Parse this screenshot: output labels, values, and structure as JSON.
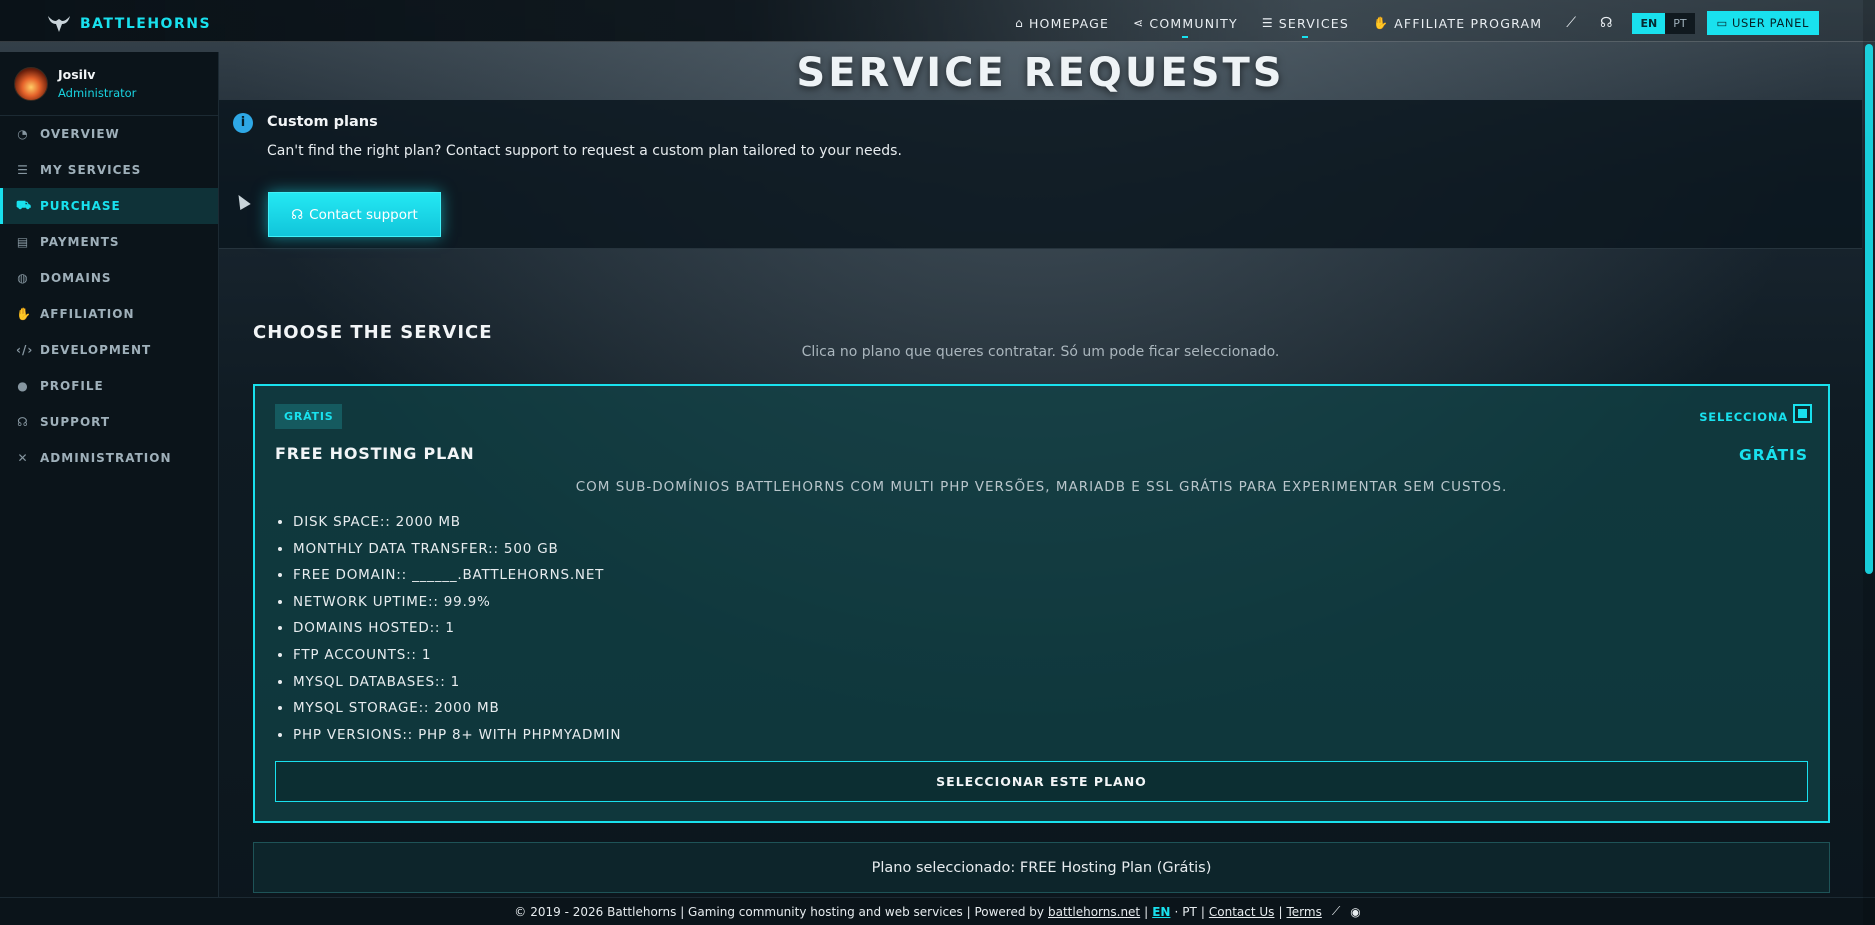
{
  "brand": {
    "name": "BATTLEHORNS"
  },
  "nav": {
    "items": [
      {
        "label": "HOMEPAGE",
        "icon": "home-icon"
      },
      {
        "label": "COMMUNITY",
        "icon": "share-icon"
      },
      {
        "label": "SERVICES",
        "icon": "server-icon"
      },
      {
        "label": "AFFILIATE PROGRAM",
        "icon": "handshake-icon"
      }
    ],
    "lang": {
      "en": "EN",
      "pt": "PT"
    },
    "user_panel": "USER PANEL"
  },
  "user": {
    "name": "Josilv",
    "role": "Administrator"
  },
  "sidebar": {
    "items": [
      {
        "label": "OVERVIEW"
      },
      {
        "label": "MY SERVICES"
      },
      {
        "label": "PURCHASE"
      },
      {
        "label": "PAYMENTS"
      },
      {
        "label": "DOMAINS"
      },
      {
        "label": "AFFILIATION"
      },
      {
        "label": "DEVELOPMENT"
      },
      {
        "label": "PROFILE"
      },
      {
        "label": "SUPPORT"
      },
      {
        "label": "ADMINISTRATION"
      }
    ]
  },
  "page": {
    "title": "SERVICE REQUESTS"
  },
  "info": {
    "title": "Custom plans",
    "text": "Can't find the right plan? Contact support to request a custom plan tailored to your needs.",
    "button": "Contact support"
  },
  "choose": {
    "title": "CHOOSE THE SERVICE",
    "subtitle": "Clica no plano que queres contratar. Só um pode ficar seleccionado."
  },
  "plan": {
    "badge": "GRÁTIS",
    "select_label": "SELECCIONA",
    "name": "FREE HOSTING PLAN",
    "price": "GRÁTIS",
    "description": "COM SUB-DOMÍNIOS BATTLEHORNS COM MULTI PHP VERSÕES, MARIADB E SSL GRÁTIS PARA EXPERIMENTAR SEM CUSTOS.",
    "features": [
      "DISK SPACE:: 2000 MB",
      "MONTHLY DATA TRANSFER:: 500 GB",
      "FREE DOMAIN:: ______.BATTLEHORNS.NET",
      "NETWORK UPTIME:: 99.9%",
      "DOMAINS HOSTED:: 1",
      "FTP ACCOUNTS:: 1",
      "MYSQL DATABASES:: 1",
      "MYSQL STORAGE:: 2000 MB",
      "PHP VERSIONS:: PHP 8+ WITH PHPMYADMIN"
    ],
    "button": "SELECCIONAR ESTE PLANO"
  },
  "selected": {
    "text": "Plano seleccionado: FREE Hosting Plan (Grátis)"
  },
  "footer": {
    "copyright": "2019 - 2026 Battlehorns | Gaming community hosting and web services | Powered by",
    "powered_link": "battlehorns.net",
    "en": "EN",
    "pt": "PT",
    "contact": "Contact Us",
    "terms": "Terms"
  },
  "colors": {
    "accent": "#19e1ee",
    "info": "#2ea8e6"
  }
}
